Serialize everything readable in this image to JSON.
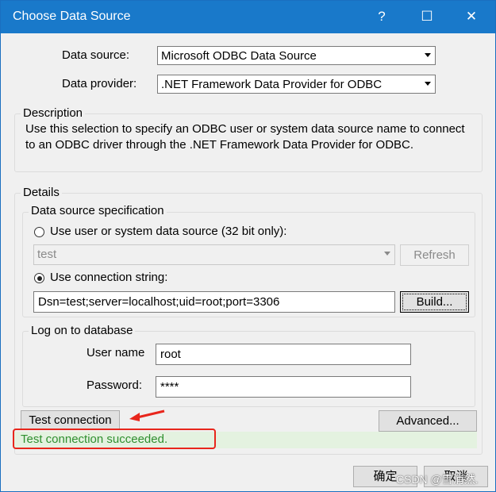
{
  "window": {
    "title": "Choose Data Source",
    "help_label": "?",
    "maximize_label": "☐",
    "close_label": "✕"
  },
  "data_source": {
    "label": "Data source:",
    "value": "Microsoft ODBC Data Source"
  },
  "data_provider": {
    "label": "Data provider:",
    "value": ".NET Framework Data Provider for ODBC"
  },
  "description": {
    "title": "Description",
    "text": "Use this selection to specify an ODBC user or system data source name to connect to an ODBC driver through the .NET Framework Data Provider for ODBC."
  },
  "details": {
    "title": "Details",
    "spec_title": "Data source specification",
    "dsn_radio_label": "Use user or system data source (32 bit only):",
    "dsn_value": "test",
    "refresh_label": "Refresh",
    "conn_radio_label": "Use connection string:",
    "conn_string": "Dsn=test;server=localhost;uid=root;port=3306",
    "build_label": "Build...",
    "logon_title": "Log on to database",
    "username_label": "User name",
    "username_value": "root",
    "password_label": "Password:",
    "password_value": "****"
  },
  "actions": {
    "test_connection_label": "Test connection",
    "advanced_label": "Advanced...",
    "status_text": "Test connection succeeded.",
    "ok_label": "确定",
    "cancel_label": "取消"
  },
  "watermark": "CSDN @雪消然.",
  "colors": {
    "titlebar": "#1979ca",
    "success_text": "#2f8f2f",
    "success_bg": "#e4f2e0",
    "annotation": "#e8261c"
  }
}
